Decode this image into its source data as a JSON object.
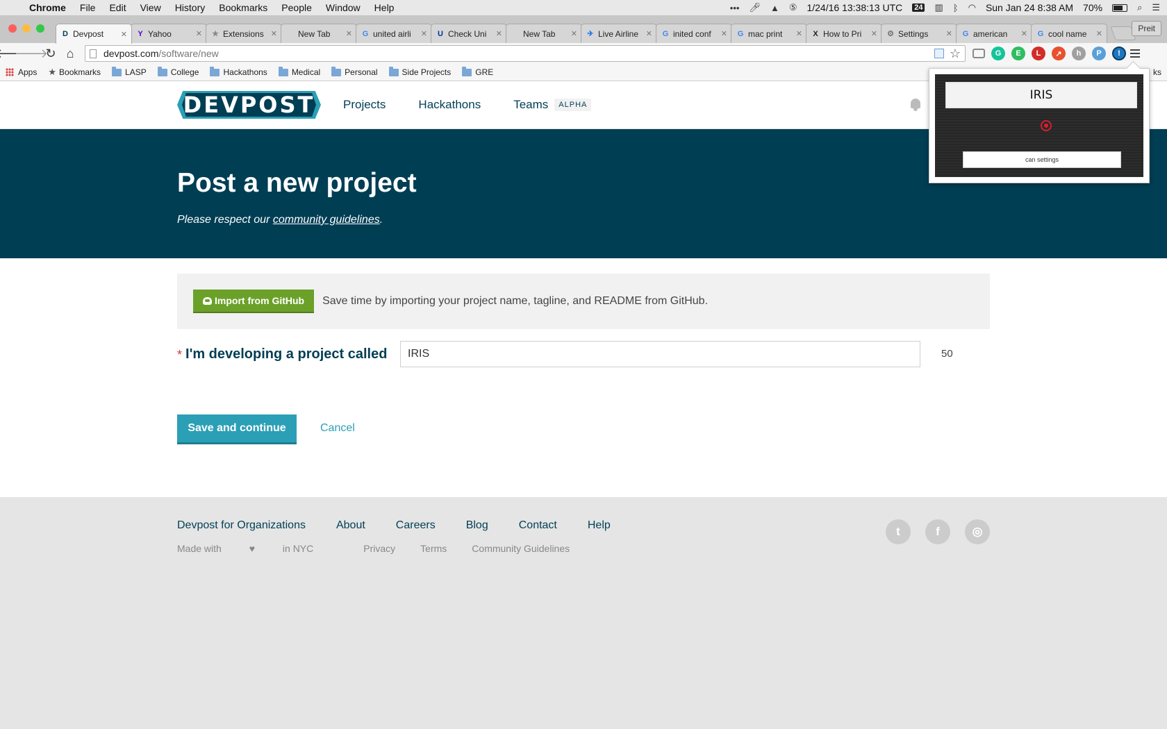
{
  "menubar": {
    "app": "Chrome",
    "items": [
      "File",
      "Edit",
      "View",
      "History",
      "Bookmarks",
      "People",
      "Window",
      "Help"
    ],
    "datetime_utc": "1/24/16 13:38:13 UTC",
    "calendar_badge": "24",
    "clock": "Sun Jan 24  8:38 AM",
    "battery": "70%"
  },
  "tabs": [
    {
      "label": "Devpost",
      "icon": "D",
      "icon_color": "#003e54",
      "active": true
    },
    {
      "label": "Yahoo",
      "icon": "Y",
      "icon_color": "#5f01d1"
    },
    {
      "label": "Extensions",
      "icon": "★",
      "icon_color": "#888888"
    },
    {
      "label": "New Tab",
      "icon": "",
      "icon_color": ""
    },
    {
      "label": "united airli",
      "icon": "G",
      "icon_color": "#4285f4"
    },
    {
      "label": "Check Uni",
      "icon": "U",
      "icon_color": "#0033a0"
    },
    {
      "label": "New Tab",
      "icon": "",
      "icon_color": ""
    },
    {
      "label": "Live Airline",
      "icon": "✈",
      "icon_color": "#1a73e8"
    },
    {
      "label": "inited conf",
      "icon": "G",
      "icon_color": "#4285f4"
    },
    {
      "label": "mac print",
      "icon": "G",
      "icon_color": "#4285f4"
    },
    {
      "label": "How to Pri",
      "icon": "X",
      "icon_color": "#222222"
    },
    {
      "label": "Settings",
      "icon": "⚙",
      "icon_color": "#777777"
    },
    {
      "label": "american",
      "icon": "G",
      "icon_color": "#4285f4"
    },
    {
      "label": "cool name",
      "icon": "G",
      "icon_color": "#4285f4"
    }
  ],
  "profile_button": "Preit",
  "toolbar": {
    "url_host": "devpost.com",
    "url_path": "/software/new"
  },
  "extensions": [
    {
      "name": "cast-icon",
      "glyph": "",
      "color": "#888888"
    },
    {
      "name": "grammarly-icon",
      "glyph": "G",
      "color": "#15c39a"
    },
    {
      "name": "evernote-icon",
      "glyph": "E",
      "color": "#2dbe60"
    },
    {
      "name": "lastpass-icon",
      "glyph": "L",
      "color": "#d32d27"
    },
    {
      "name": "hoverzoom-icon",
      "glyph": "↗",
      "color": "#e8502e"
    },
    {
      "name": "honey-icon",
      "glyph": "h",
      "color": "#a0a0a0"
    },
    {
      "name": "pinterest-icon",
      "glyph": "P",
      "color": "#5aa0d8"
    },
    {
      "name": "iris-extension-icon",
      "glyph": "!",
      "color": "#1c77c3"
    }
  ],
  "bookmarks": {
    "apps": "Apps",
    "items": [
      "Bookmarks",
      "LASP",
      "College",
      "Hackathons",
      "Medical",
      "Personal",
      "Side Projects",
      "GRE"
    ],
    "overflow": "ks"
  },
  "site": {
    "logo": "DEVPOST",
    "nav": [
      "Projects",
      "Hackathons",
      "Teams"
    ],
    "teams_badge": "ALPHA"
  },
  "hero": {
    "title": "Post a new project",
    "subtitle_prefix": "Please respect our ",
    "subtitle_link": "community guidelines",
    "subtitle_suffix": "."
  },
  "import": {
    "button": "Import from GitHub",
    "text": "Save time by importing your project name, tagline, and README from GitHub."
  },
  "form": {
    "required_mark": "*",
    "label": "I'm developing a project called",
    "value": "IRIS",
    "counter": "50",
    "save": "Save and continue",
    "cancel": "Cancel"
  },
  "footer": {
    "links": [
      "Devpost for Organizations",
      "About",
      "Careers",
      "Blog",
      "Contact",
      "Help"
    ],
    "made_with_prefix": "Made with",
    "heart": "♥",
    "made_with_suffix": "in NYC",
    "sub_links": [
      "Privacy",
      "Terms",
      "Community Guidelines"
    ],
    "socials": [
      {
        "name": "twitter-icon",
        "glyph": "t"
      },
      {
        "name": "facebook-icon",
        "glyph": "f"
      },
      {
        "name": "instagram-icon",
        "glyph": "◎"
      }
    ]
  },
  "popup": {
    "name": "IRIS",
    "button": "can settings"
  }
}
